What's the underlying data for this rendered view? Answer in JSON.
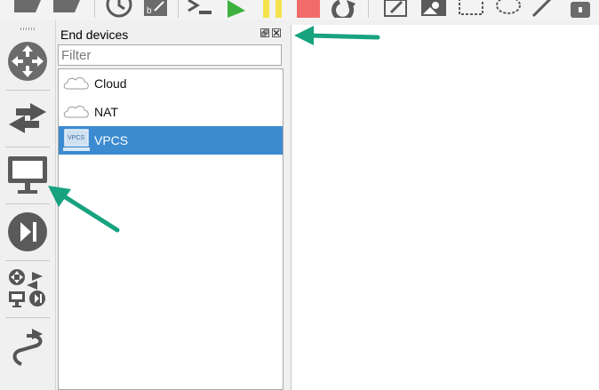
{
  "toolbar": {
    "icons": [
      "open-folder-icon",
      "open-folder-icon",
      "clock-icon",
      "snapshot-icon",
      "console-icon",
      "play-icon",
      "pause-icon",
      "stop-icon",
      "reload-icon",
      "edit-note-icon",
      "insert-picture-icon",
      "rectangle-icon",
      "ellipse-icon",
      "line-icon",
      "lock-icon"
    ],
    "colors": {
      "play": "#3fb13f",
      "pause": "#f3e34a",
      "stop": "#f26b6b"
    }
  },
  "left_toolbar": {
    "items": [
      "routers",
      "switches",
      "end-devices",
      "security-devices",
      "all-devices",
      "add-link"
    ]
  },
  "dock": {
    "title": "End devices",
    "filter_placeholder": "Filter",
    "devices": [
      {
        "label": "Cloud",
        "icon": "cloud-icon",
        "selected": false
      },
      {
        "label": "NAT",
        "icon": "cloud-icon",
        "selected": false
      },
      {
        "label": "VPCS",
        "icon": "vpcs-computer-icon",
        "selected": true,
        "icon_text": "VPCS"
      }
    ]
  },
  "annotation_color": "#17a37f"
}
